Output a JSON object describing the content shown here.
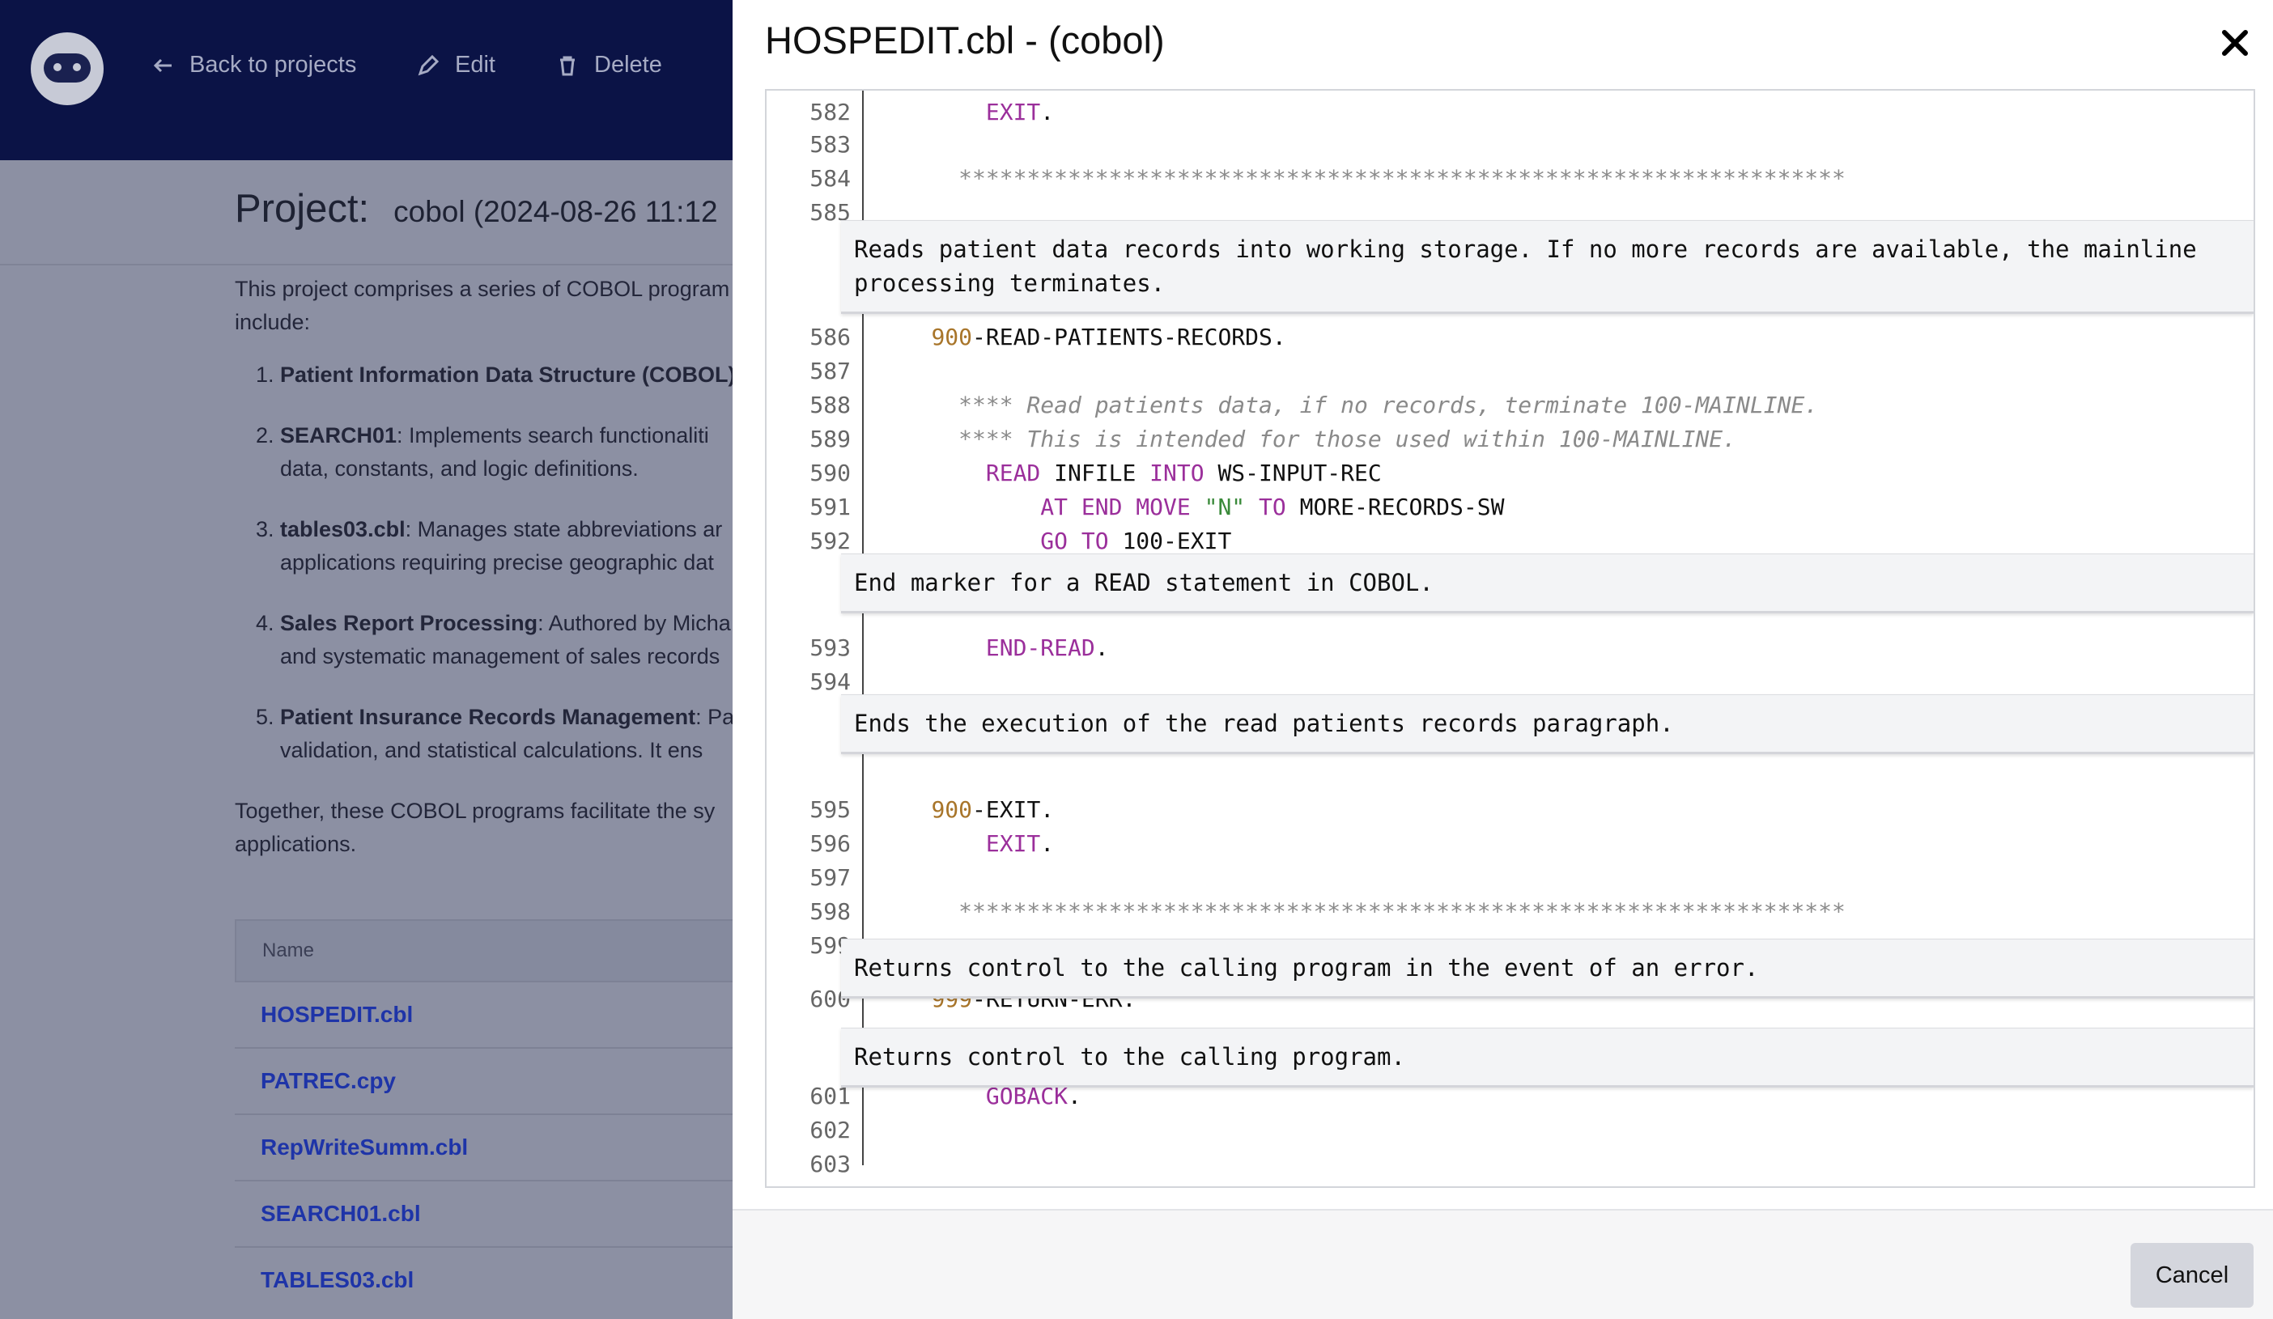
{
  "nav": {
    "back_label": "Back to projects",
    "edit_label": "Edit",
    "delete_label": "Delete"
  },
  "project": {
    "title": "Project:",
    "subtitle": "cobol (2024-08-26 11:12",
    "intro_1": "This project comprises a series of COBOL program",
    "intro_2": "include:",
    "items": [
      {
        "bold": "Patient Information Data Structure (COBOL)",
        "line1": "",
        "line2": ""
      },
      {
        "bold": "SEARCH01",
        "line1": ": Implements search functionaliti",
        "line2": "data, constants, and logic definitions."
      },
      {
        "bold": "tables03.cbl",
        "line1": ": Manages state abbreviations ar",
        "line2": "applications requiring precise geographic dat"
      },
      {
        "bold": "Sales Report Processing",
        "line1": ": Authored by Micha",
        "line2": "and systematic management of sales records"
      },
      {
        "bold": "Patient Insurance Records Management",
        "line1": ": Pa",
        "line2": "validation, and statistical calculations. It ens"
      }
    ],
    "outro_1": "Together, these COBOL programs facilitate the sy",
    "outro_2": "applications.",
    "table_header": "Name",
    "files": [
      "HOSPEDIT.cbl",
      "PATREC.cpy",
      "RepWriteSumm.cbl",
      "SEARCH01.cbl",
      "TABLES03.cbl"
    ]
  },
  "modal": {
    "title": "HOSPEDIT.cbl - (cobol)",
    "cancel_label": "Cancel"
  },
  "code_lines": [
    {
      "n": "582",
      "parts": [
        [
          "",
          "        "
        ],
        [
          "kw",
          "EXIT"
        ],
        [
          "",
          "."
        ]
      ]
    },
    {
      "n": "583",
      "parts": []
    },
    {
      "n": "584",
      "parts": [
        [
          "cmt",
          "      *****************************************************************"
        ]
      ]
    },
    {
      "n": "585",
      "parts": []
    },
    {
      "n": "586",
      "parts": [
        [
          "",
          "    "
        ],
        [
          "num",
          "900"
        ],
        [
          "",
          "-READ-PATIENTS-RECORDS."
        ]
      ]
    },
    {
      "n": "587",
      "parts": []
    },
    {
      "n": "588",
      "parts": [
        [
          "cmt",
          "      **** Read patients data, if no records, terminate 100-MAINLINE."
        ]
      ]
    },
    {
      "n": "589",
      "parts": [
        [
          "cmt",
          "      **** This is intended for those used within 100-MAINLINE."
        ]
      ]
    },
    {
      "n": "590",
      "parts": [
        [
          "",
          "        "
        ],
        [
          "kw",
          "READ"
        ],
        [
          "",
          " INFILE "
        ],
        [
          "kw",
          "INTO"
        ],
        [
          "",
          " WS-INPUT-REC"
        ]
      ]
    },
    {
      "n": "591",
      "parts": [
        [
          "",
          "            "
        ],
        [
          "kw",
          "AT END MOVE"
        ],
        [
          "",
          " "
        ],
        [
          "str",
          "\"N\""
        ],
        [
          "",
          " "
        ],
        [
          "kw",
          "TO"
        ],
        [
          "",
          " MORE-RECORDS-SW"
        ]
      ]
    },
    {
      "n": "592",
      "parts": [
        [
          "",
          "            "
        ],
        [
          "kw",
          "GO TO"
        ],
        [
          "",
          " 100-EXIT"
        ]
      ]
    },
    {
      "n": "593",
      "parts": [
        [
          "",
          "        "
        ],
        [
          "kw",
          "END-READ"
        ],
        [
          "",
          "."
        ]
      ]
    },
    {
      "n": "594",
      "parts": []
    },
    {
      "n": "595",
      "parts": [
        [
          "",
          "    "
        ],
        [
          "num",
          "900"
        ],
        [
          "",
          "-EXIT."
        ]
      ]
    },
    {
      "n": "596",
      "parts": [
        [
          "",
          "        "
        ],
        [
          "kw",
          "EXIT"
        ],
        [
          "",
          "."
        ]
      ]
    },
    {
      "n": "597",
      "parts": []
    },
    {
      "n": "598",
      "parts": [
        [
          "cmt",
          "      *****************************************************************"
        ]
      ]
    },
    {
      "n": "599",
      "parts": []
    },
    {
      "n": "600",
      "parts": [
        [
          "",
          "    "
        ],
        [
          "num",
          "999"
        ],
        [
          "",
          "-RETURN-ERR."
        ]
      ]
    },
    {
      "n": "601",
      "parts": [
        [
          "",
          "        "
        ],
        [
          "kw",
          "GOBACK"
        ],
        [
          "",
          "."
        ]
      ]
    },
    {
      "n": "602",
      "parts": []
    },
    {
      "n": "603",
      "parts": []
    }
  ],
  "annotations": [
    "Reads patient data records into working storage. If no more records are available, the mainline processing terminates.",
    "End marker for a READ statement in COBOL.",
    "Ends the execution of the read patients records paragraph.",
    "Returns control to the calling program in the event of an error.",
    "Returns control to the calling program."
  ]
}
